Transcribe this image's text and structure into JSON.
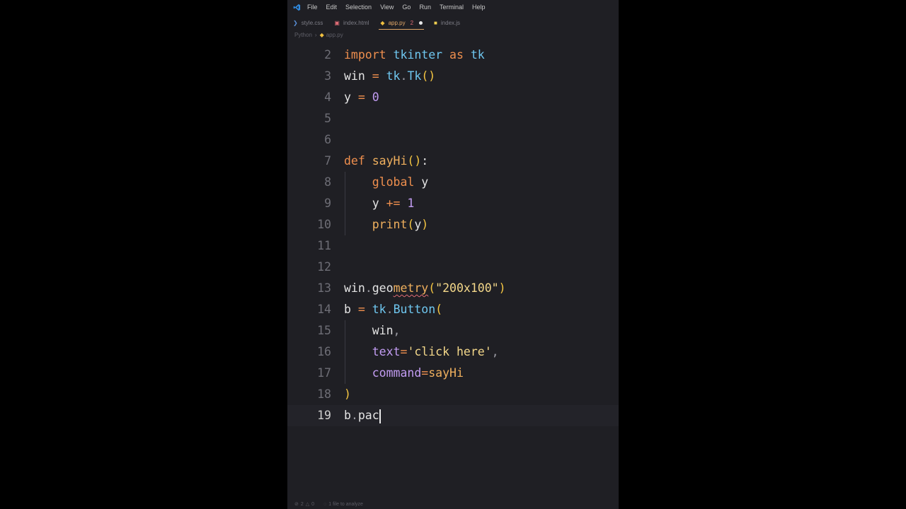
{
  "menu": [
    "File",
    "Edit",
    "Selection",
    "View",
    "Go",
    "Run",
    "Terminal",
    "Help"
  ],
  "tabs": [
    {
      "name": "style.css",
      "icon": "css-file-icon",
      "glyph": "❯",
      "color": "#5a8fd8",
      "active": false
    },
    {
      "name": "index.html",
      "icon": "html-file-icon",
      "glyph": "▣",
      "color": "#e06c75",
      "active": false
    },
    {
      "name": "app.py",
      "icon": "python-file-icon",
      "glyph": "◆",
      "color": "#f0c040",
      "active": true,
      "problems": "2",
      "modified": true
    },
    {
      "name": "index.js",
      "icon": "js-file-icon",
      "glyph": "■",
      "color": "#f0d050",
      "active": false
    }
  ],
  "breadcrumb": {
    "lang": "Python",
    "file": "app.py"
  },
  "code": [
    {
      "n": "2",
      "tokens": [
        [
          "kw",
          "import"
        ],
        [
          "id",
          " "
        ],
        [
          "mod",
          "tkinter"
        ],
        [
          "id",
          " "
        ],
        [
          "kw",
          "as"
        ],
        [
          "id",
          " "
        ],
        [
          "mod",
          "tk"
        ]
      ]
    },
    {
      "n": "3",
      "tokens": [
        [
          "id",
          "win "
        ],
        [
          "op",
          "="
        ],
        [
          "id",
          " "
        ],
        [
          "mod",
          "tk"
        ],
        [
          "punc",
          "."
        ],
        [
          "mod",
          "Tk"
        ],
        [
          "par",
          "()"
        ]
      ]
    },
    {
      "n": "4",
      "tokens": [
        [
          "id",
          "y "
        ],
        [
          "op",
          "="
        ],
        [
          "id",
          " "
        ],
        [
          "num",
          "0"
        ]
      ]
    },
    {
      "n": "5",
      "tokens": []
    },
    {
      "n": "6",
      "tokens": []
    },
    {
      "n": "7",
      "tokens": [
        [
          "kw",
          "def"
        ],
        [
          "id",
          " "
        ],
        [
          "fn",
          "sayHi"
        ],
        [
          "par",
          "()"
        ],
        [
          "id",
          ":"
        ]
      ]
    },
    {
      "n": "8",
      "indent": true,
      "tokens": [
        [
          "id",
          "    "
        ],
        [
          "kw",
          "global"
        ],
        [
          "id",
          " y"
        ]
      ]
    },
    {
      "n": "9",
      "indent": true,
      "tokens": [
        [
          "id",
          "    y "
        ],
        [
          "op",
          "+="
        ],
        [
          "id",
          " "
        ],
        [
          "num",
          "1"
        ]
      ]
    },
    {
      "n": "10",
      "indent": true,
      "tokens": [
        [
          "id",
          "    "
        ],
        [
          "fn",
          "print"
        ],
        [
          "par",
          "("
        ],
        [
          "id",
          "y"
        ],
        [
          "par",
          ")"
        ]
      ]
    },
    {
      "n": "11",
      "tokens": []
    },
    {
      "n": "12",
      "tokens": []
    },
    {
      "n": "13",
      "tokens": [
        [
          "id",
          "win"
        ],
        [
          "punc",
          "."
        ],
        [
          "id",
          "geo"
        ],
        [
          "squig",
          "metry"
        ],
        [
          "par",
          "("
        ],
        [
          "str",
          "\"200x100\""
        ],
        [
          "par",
          ")"
        ]
      ]
    },
    {
      "n": "14",
      "tokens": [
        [
          "id",
          "b "
        ],
        [
          "op",
          "="
        ],
        [
          "id",
          " "
        ],
        [
          "mod",
          "tk"
        ],
        [
          "punc",
          "."
        ],
        [
          "mod",
          "Button"
        ],
        [
          "par",
          "("
        ]
      ]
    },
    {
      "n": "15",
      "indent": true,
      "tokens": [
        [
          "id",
          "    win"
        ],
        [
          "punc",
          ","
        ]
      ]
    },
    {
      "n": "16",
      "indent": true,
      "tokens": [
        [
          "id",
          "    "
        ],
        [
          "param",
          "text"
        ],
        [
          "op",
          "="
        ],
        [
          "str",
          "'click here'"
        ],
        [
          "punc",
          ","
        ]
      ]
    },
    {
      "n": "17",
      "indent": true,
      "tokens": [
        [
          "id",
          "    "
        ],
        [
          "param",
          "command"
        ],
        [
          "op",
          "="
        ],
        [
          "fn",
          "sayHi"
        ]
      ]
    },
    {
      "n": "18",
      "tokens": [
        [
          "par",
          ")"
        ]
      ]
    },
    {
      "n": "19",
      "current": true,
      "caret": true,
      "tokens": [
        [
          "id",
          "b"
        ],
        [
          "punc",
          "."
        ],
        [
          "id",
          "pac"
        ]
      ]
    }
  ],
  "status": {
    "errors": "2",
    "warnings": "0",
    "analyze": "1 file to analyze"
  },
  "colors": {
    "editor_bg": "#1f1f24",
    "accent": "#e2a868"
  }
}
